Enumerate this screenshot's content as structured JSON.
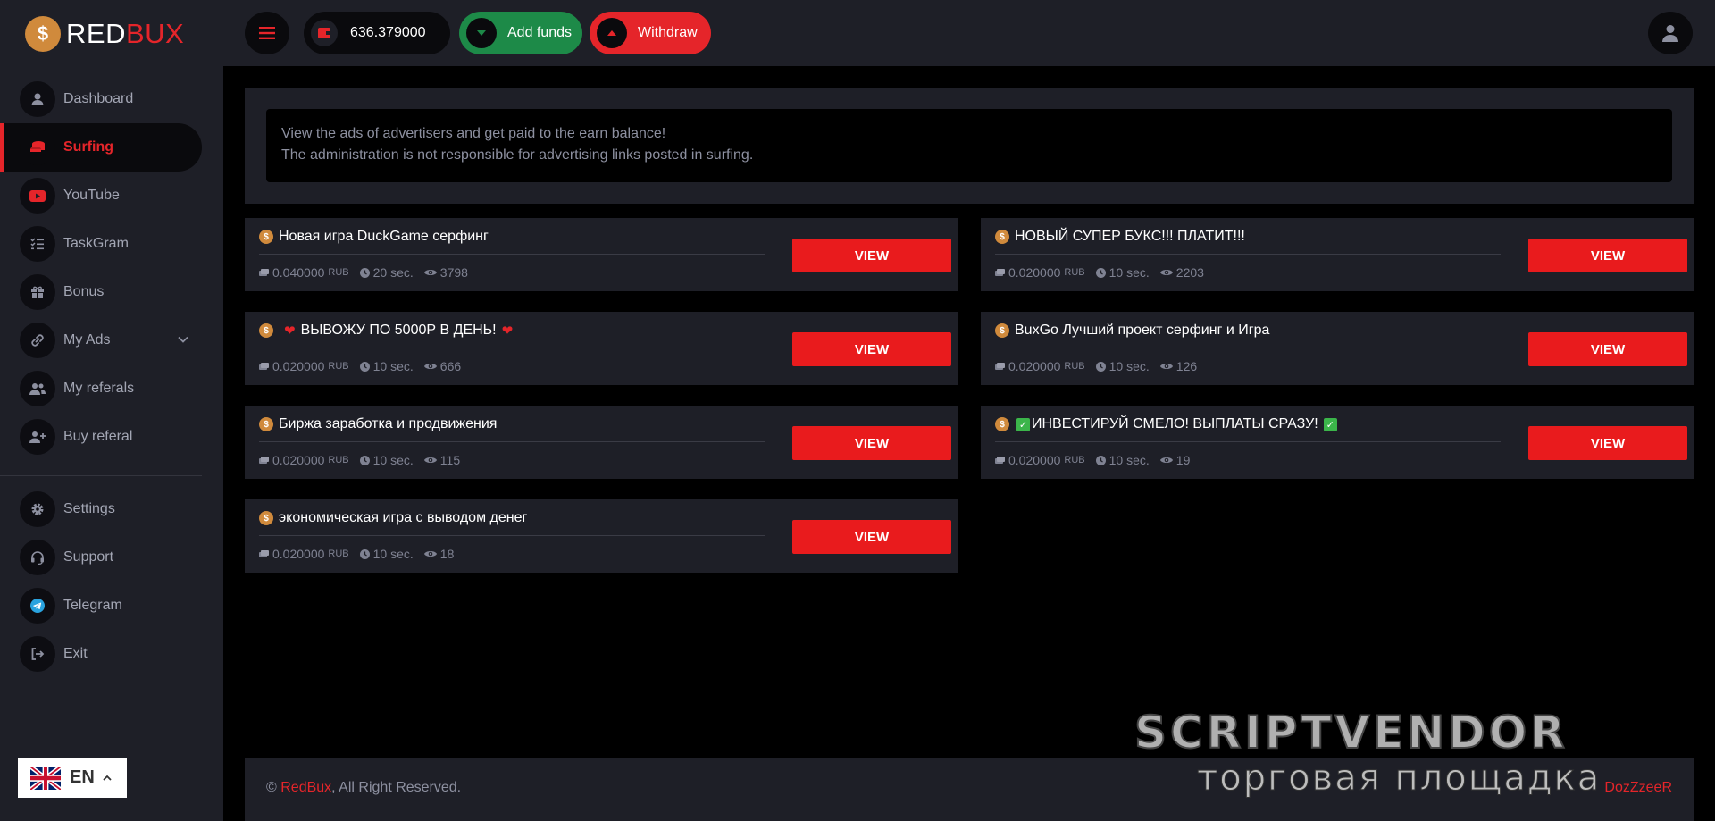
{
  "brand": {
    "name_white": "RED",
    "name_red": "BUX",
    "coin_symbol": "$"
  },
  "sidebar": {
    "items": [
      {
        "label": "Dashboard",
        "icon": "user-icon"
      },
      {
        "label": "Surfing",
        "icon": "coins-icon",
        "active": true
      },
      {
        "label": "YouTube",
        "icon": "youtube-icon"
      },
      {
        "label": "TaskGram",
        "icon": "tasks-icon"
      },
      {
        "label": "Bonus",
        "icon": "gift-icon"
      },
      {
        "label": "My Ads",
        "icon": "link-icon",
        "expandable": true
      },
      {
        "label": "My referals",
        "icon": "users-icon"
      },
      {
        "label": "Buy referal",
        "icon": "user-plus-icon"
      },
      {
        "label": "Settings",
        "icon": "gear-icon"
      },
      {
        "label": "Support",
        "icon": "headset-icon"
      },
      {
        "label": "Telegram",
        "icon": "telegram-icon"
      },
      {
        "label": "Exit",
        "icon": "exit-icon"
      }
    ],
    "language": {
      "code": "EN",
      "flag": "uk-flag-icon"
    }
  },
  "topbar": {
    "balance": "636.379000",
    "add_funds_label": "Add funds",
    "withdraw_label": "Withdraw"
  },
  "info": {
    "line1": "View the ads of advertisers and get paid to the earn balance!",
    "line2": "The administration is not responsible for advertising links posted in surfing."
  },
  "ads": [
    {
      "title": "Новая игра DuckGame серфинг",
      "price": "0.040000",
      "currency": "RUB",
      "time": "20 sec.",
      "views": "3798",
      "button": "VIEW"
    },
    {
      "title": "НОВЫЙ СУПЕР БУКС!!! ПЛАТИТ!!!",
      "price": "0.020000",
      "currency": "RUB",
      "time": "10 sec.",
      "views": "2203",
      "button": "VIEW"
    },
    {
      "title": "ВЫВОЖУ ПО 5000Р В ДЕНЬ!",
      "price": "0.020000",
      "currency": "RUB",
      "time": "10 sec.",
      "views": "666",
      "button": "VIEW"
    },
    {
      "title": "BuxGo Лучший проект серфинг и Игра",
      "price": "0.020000",
      "currency": "RUB",
      "time": "10 sec.",
      "views": "126",
      "button": "VIEW"
    },
    {
      "title": "Биржа заработка и продвижения",
      "price": "0.020000",
      "currency": "RUB",
      "time": "10 sec.",
      "views": "115",
      "button": "VIEW"
    },
    {
      "title": "ИНВЕСТИРУЙ СМЕЛО! ВЫПЛАТЫ СРАЗУ!",
      "price": "0.020000",
      "currency": "RUB",
      "time": "10 sec.",
      "views": "19",
      "button": "VIEW"
    },
    {
      "title": "экономическая игра с выводом денег",
      "price": "0.020000",
      "currency": "RUB",
      "time": "10 sec.",
      "views": "18",
      "button": "VIEW"
    }
  ],
  "footer": {
    "copyright_symbol": "©",
    "site_link": "RedBux",
    "rights": ", All Right Reserved.",
    "author": "DozZzeeR"
  },
  "watermark": {
    "top": "SCRIPTVENDOR",
    "bottom": "торговая площадка"
  },
  "colors": {
    "accent": "#e5252a",
    "success": "#1d8a48",
    "panel": "#1e1f27",
    "background": "#000000",
    "coin": "#d08a3c"
  }
}
